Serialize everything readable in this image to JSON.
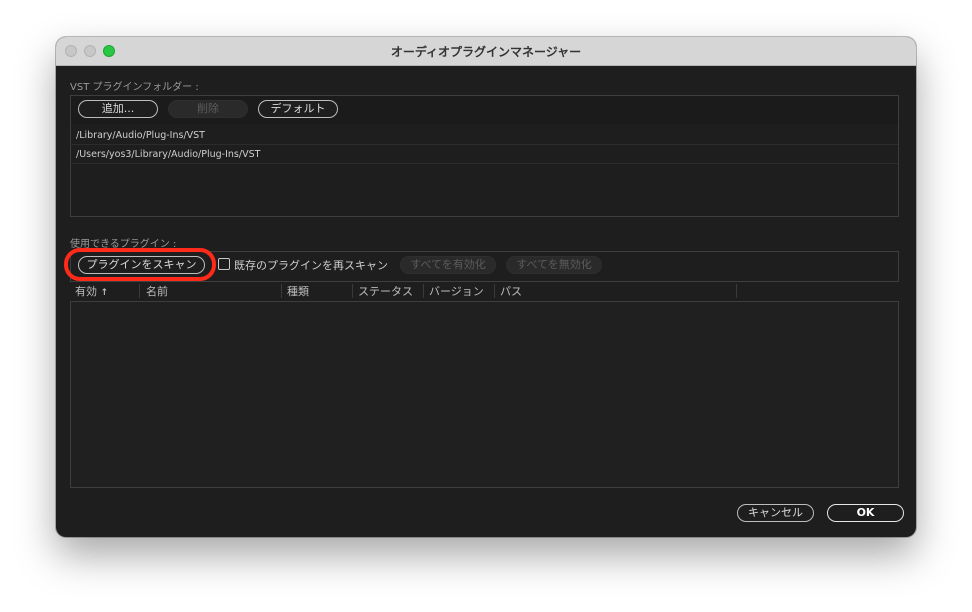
{
  "window": {
    "title": "オーディオプラグインマネージャー"
  },
  "vst_folders": {
    "label": "VST プラグインフォルダー :",
    "add_label": "追加...",
    "delete_label": "削除",
    "default_label": "デフォルト",
    "paths": [
      "/Library/Audio/Plug-Ins/VST",
      "/Users/yos3/Library/Audio/Plug-Ins/VST"
    ]
  },
  "plugins": {
    "label": "使用できるプラグイン :",
    "scan_label": "プラグインをスキャン",
    "rescan_label": "既存のプラグインを再スキャン",
    "rescan_checked": false,
    "enable_all_label": "すべてを有効化",
    "disable_all_label": "すべてを無効化",
    "columns": {
      "enabled": "有効",
      "sort_indicator": "↑",
      "name": "名前",
      "type": "種類",
      "status": "ステータス",
      "version": "バージョン",
      "path": "パス"
    }
  },
  "footer": {
    "cancel_label": "キャンセル",
    "ok_label": "OK"
  },
  "colors": {
    "highlight": "#ff2a1a",
    "window_bg": "#1e1e1e",
    "zoom_button": "#2ac842"
  }
}
